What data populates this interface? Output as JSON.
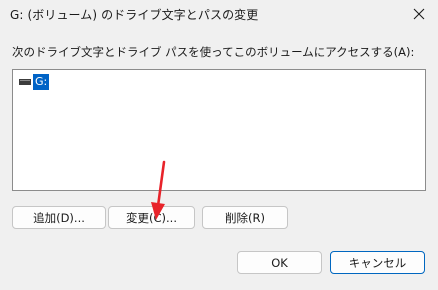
{
  "window": {
    "title": "G: (ボリューム) のドライブ文字とパスの変更",
    "close_icon": "close-icon"
  },
  "prompt": {
    "text": "次のドライブ文字とドライブ パスを使ってこのボリュームにアクセスする(A):"
  },
  "list": {
    "items": [
      {
        "label": "G:",
        "icon": "drive-icon",
        "selected": true
      }
    ]
  },
  "buttons": {
    "add_label": "追加(D)...",
    "change_label": "変更(C)...",
    "remove_label": "削除(R)",
    "ok_label": "OK",
    "cancel_label": "キャンセル"
  },
  "colors": {
    "selection": "#0063c6",
    "default_button_border": "#0067c0",
    "annotation_arrow": "#e8232a"
  }
}
